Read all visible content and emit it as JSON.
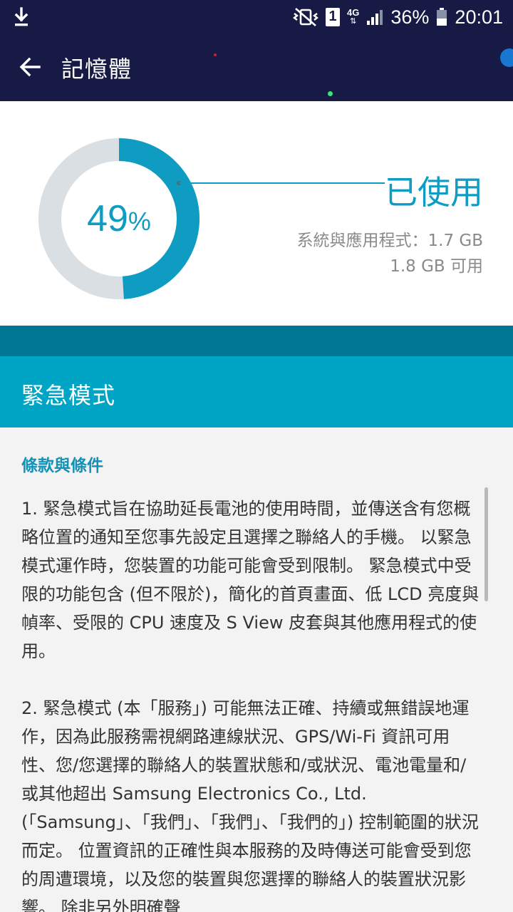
{
  "status_bar": {
    "battery_percent": "36%",
    "time": "20:01",
    "sim_slot": "1",
    "network_type": "4G",
    "icons": [
      "download-icon",
      "mute-vibrate-icon",
      "sim-card-icon",
      "network-4g-icon",
      "signal-icon",
      "battery-icon"
    ]
  },
  "app_bar": {
    "title": "記憶體",
    "back_icon": "arrow-left-icon"
  },
  "memory": {
    "used_percent": 49,
    "percent_value": "49",
    "percent_sign": "%",
    "used_label": "已使用",
    "system_apps": "系統與應用程式：1.7 GB",
    "available": "1.8 GB 可用"
  },
  "dialog": {
    "title": "緊急模式",
    "subheading": "條款與條件",
    "paragraphs": [
      "1. 緊急模式旨在協助延長電池的使用時間，並傳送含有您概略位置的通知至您事先設定且選擇之聯絡人的手機。 以緊急模式運作時，您裝置的功能可能會受到限制。 緊急模式中受限的功能包含 (但不限於)，簡化的首頁畫面、低 LCD 亮度與幀率、受限的 CPU 速度及 S View 皮套與其他應用程式的使用。",
      "2. 緊急模式 (本「服務」) 可能無法正確、持續或無錯誤地運作，因為此服務需視網路連線狀況、GPS/Wi-Fi 資訊可用性、您/您選擇的聯絡人的裝置狀態和/或狀況、電池電量和/或其他超出 Samsung Electronics Co., Ltd. (「Samsung」、「我們」、「我們」、「我們的」) 控制範圍的狀況而定。 位置資訊的正確性與本服務的及時傳送可能會受到您的周遭環境，以及您的裝置與您選擇的聯絡人的裝置狀況影響。 除非另外明確聲"
    ]
  },
  "colors": {
    "app_bar": "#161a44",
    "accent": "#0f9cc2",
    "header": "#00a4c4",
    "stripe": "#007893",
    "donut_track": "#d9dfe2"
  }
}
